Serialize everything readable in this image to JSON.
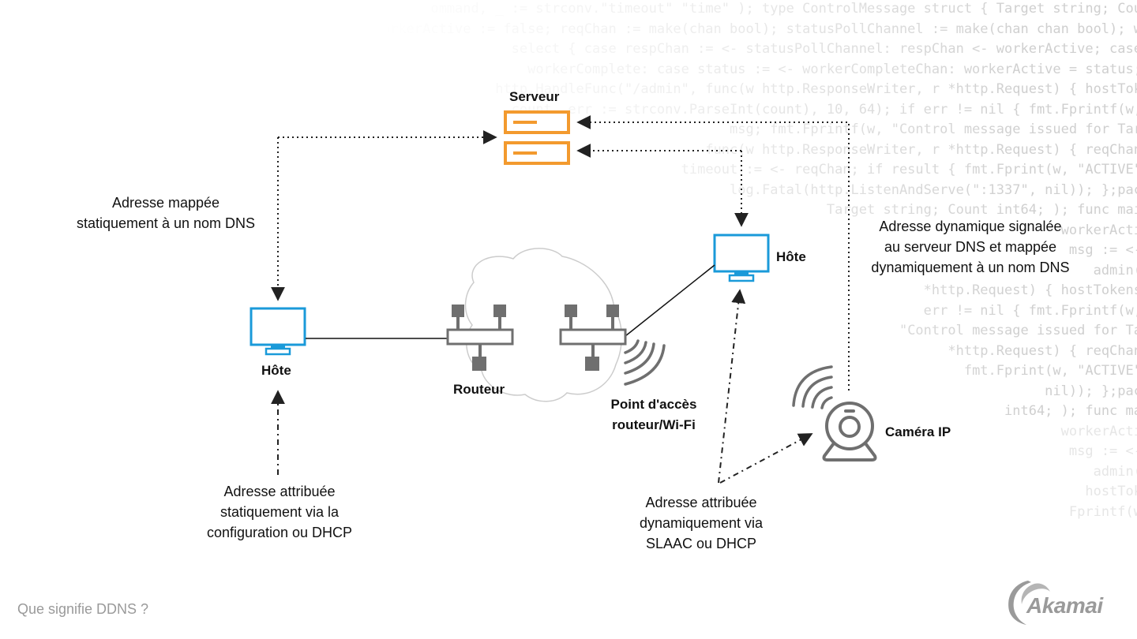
{
  "background_code": [
    "ommand, _ := strconv.\"timeout\" \"time\" ); type ControlMessage struct { Target string; Cou",
    "    workerActive := false; reqChan := make(chan bool); statusPollChannel := make(chan chan bool); w",
    "   select { case respChan := <- statusPollChannel: respChan <- workerActive; case",
    "     workerComplete: case status := <- workerCompleteChan: workerActive = status;",
    "  http.HandleFunc(\"/admin\", func(w http.ResponseWriter, r *http.Request) { hostTok",
    " count, err := strconv.ParseInt(count), 10, 64); if err != nil { fmt.Fprintf(w,",
    "   msg; fmt.Fprintf(w, \"Control message issued for Tar",
    "  func(w http.ResponseWriter, r *http.Request) { reqChan",
    "  timeout := <- reqChan; if result { fmt.Fprint(w, \"ACTIVE\"",
    "   log.Fatal(http.ListenAndServe(\":1337\", nil)); };pac",
    "  Target string; Count int64; ); func mai",
    "  workerActi",
    "  msg := <-",
    "  admin(",
    "  *http.Request) { hostTokens",
    "  err != nil { fmt.Fprintf(w,",
    "  \"Control message issued for Ta",
    "  *http.Request) { reqChan",
    "  fmt.Fprint(w, \"ACTIVE\"",
    "  nil)); };pac",
    "  int64; ); func ma",
    "  workerActi",
    "  msg := <-",
    "  admin(",
    "  hostTok",
    "  Fprintf(w"
  ],
  "nodes": {
    "server": {
      "label": "Serveur"
    },
    "host_left": {
      "label": "Hôte"
    },
    "host_right": {
      "label": "Hôte"
    },
    "router": {
      "label": "Routeur"
    },
    "access_point": {
      "label_lines": [
        "Point d'accès",
        "routeur/Wi-Fi"
      ]
    },
    "camera": {
      "label": "Caméra IP"
    }
  },
  "annotations": {
    "static_dns": [
      "Adresse mappée",
      "statiquement à un nom DNS"
    ],
    "dynamic_dns": [
      "Adresse dynamique signalée",
      "au serveur DNS et mappée",
      "dynamiquement à un nom DNS"
    ],
    "static_assign": [
      "Adresse attribuée",
      "statiquement via la",
      "configuration ou DHCP"
    ],
    "dynamic_assign": [
      "Adresse attribuée",
      "dynamiquement via",
      "SLAAC ou DHCP"
    ]
  },
  "footer": {
    "caption": "Que signifie DDNS ?",
    "logo_text": "Akamai"
  },
  "colors": {
    "server": "#f39a2e",
    "host": "#1a9ad9",
    "network_gray": "#6f6f6f",
    "cloud": "#cccccc",
    "arrow": "#222222",
    "caption": "#9a9a9a"
  }
}
